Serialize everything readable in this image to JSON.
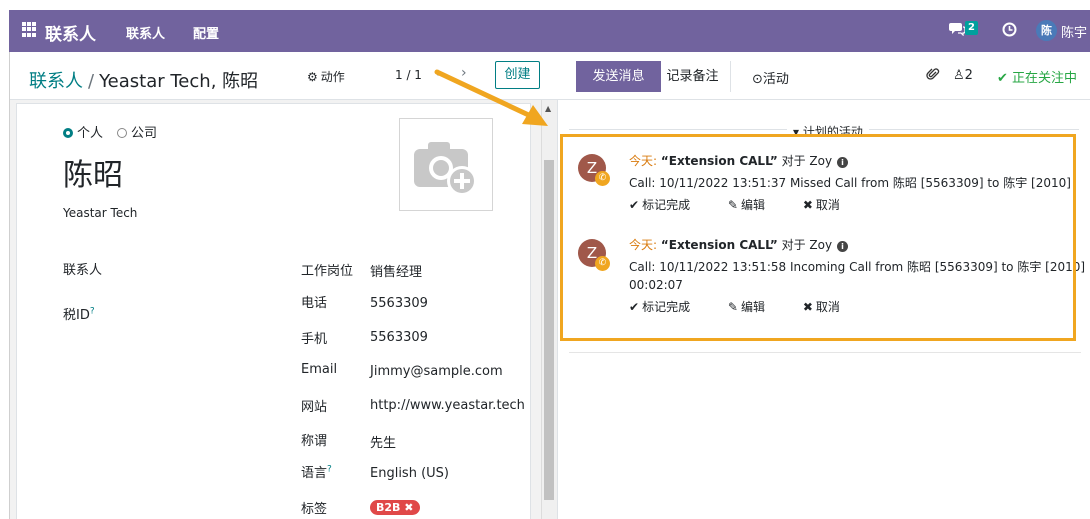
{
  "navbar": {
    "app_title": "联系人",
    "menu_contacts": "联系人",
    "menu_config": "配置",
    "chat_count": "2",
    "avatar_initial": "陈",
    "user_name": "陈宇",
    "accent": "#71639e"
  },
  "control": {
    "breadcrumb_parent": "联系人",
    "breadcrumb_sep": "/",
    "breadcrumb_current": "Yeastar Tech, 陈昭",
    "action_label": "动作",
    "pager": "1 / 1",
    "prev_icon": "‹",
    "next_icon": "›",
    "create_label": "创建"
  },
  "form": {
    "radio_person": "个人",
    "radio_company": "公司",
    "name": "陈昭",
    "company": "Yeastar Tech",
    "left_labels": [
      "联系人",
      "税ID"
    ],
    "tax_help": "?",
    "fields": [
      {
        "label": "工作岗位",
        "value": "销售经理"
      },
      {
        "label": "电话",
        "value": "5563309"
      },
      {
        "label": "手机",
        "value": "5563309"
      },
      {
        "label": "Email",
        "value": "Jimmy@sample.com"
      },
      {
        "label": "网站",
        "value": "http://www.yeastar.tech"
      },
      {
        "label": "称谓",
        "value": "先生"
      },
      {
        "label": "语言",
        "value": "English (US)",
        "help": "?"
      },
      {
        "label": "标签",
        "value": ""
      }
    ],
    "tag": "B2B",
    "tag_remove": "✖"
  },
  "chatter": {
    "send_message": "发送消息",
    "log_note": "记录备注",
    "activities": "活动",
    "followers_count": "2",
    "following": "正在关注中",
    "planned_activities": "计划的活动",
    "items": [
      {
        "avatar": "Z",
        "today": "今天:",
        "summary": "“Extension CALL”",
        "for_text": "对于 Zoy",
        "note_line1": "Call: 10/11/2022 13:51:37 Missed Call from 陈昭 [5563309] to 陈宇 [2010]",
        "note_line2": ""
      },
      {
        "avatar": "Z",
        "today": "今天:",
        "summary": "“Extension CALL”",
        "for_text": "对于 Zoy",
        "note_line1": "Call: 10/11/2022 13:51:58 Incoming Call from 陈昭 [5563309] to 陈宇 [2010]",
        "note_line2": "00:02:07"
      }
    ],
    "mark_done": "标记完成",
    "edit": "编辑",
    "cancel": "取消",
    "highlight_color": "#f0a620"
  }
}
